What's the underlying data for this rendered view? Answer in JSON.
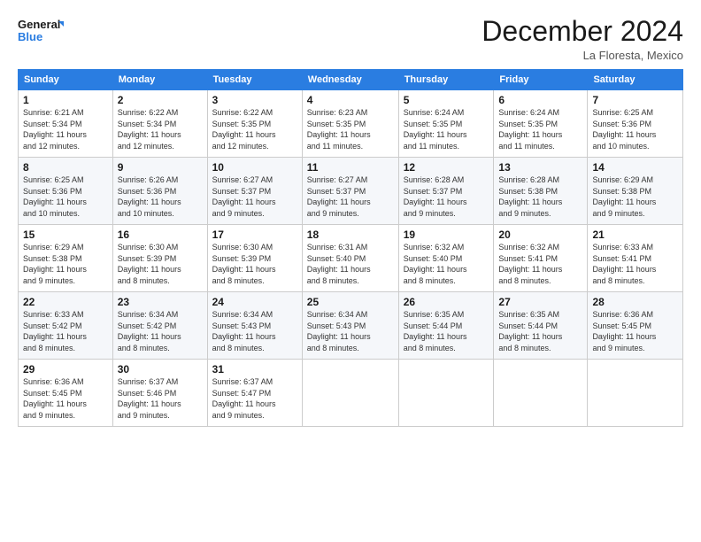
{
  "logo": {
    "line1": "General",
    "line2": "Blue"
  },
  "title": "December 2024",
  "location": "La Floresta, Mexico",
  "days_of_week": [
    "Sunday",
    "Monday",
    "Tuesday",
    "Wednesday",
    "Thursday",
    "Friday",
    "Saturday"
  ],
  "weeks": [
    [
      {
        "day": "1",
        "info": "Sunrise: 6:21 AM\nSunset: 5:34 PM\nDaylight: 11 hours\nand 12 minutes."
      },
      {
        "day": "2",
        "info": "Sunrise: 6:22 AM\nSunset: 5:34 PM\nDaylight: 11 hours\nand 12 minutes."
      },
      {
        "day": "3",
        "info": "Sunrise: 6:22 AM\nSunset: 5:35 PM\nDaylight: 11 hours\nand 12 minutes."
      },
      {
        "day": "4",
        "info": "Sunrise: 6:23 AM\nSunset: 5:35 PM\nDaylight: 11 hours\nand 11 minutes."
      },
      {
        "day": "5",
        "info": "Sunrise: 6:24 AM\nSunset: 5:35 PM\nDaylight: 11 hours\nand 11 minutes."
      },
      {
        "day": "6",
        "info": "Sunrise: 6:24 AM\nSunset: 5:35 PM\nDaylight: 11 hours\nand 11 minutes."
      },
      {
        "day": "7",
        "info": "Sunrise: 6:25 AM\nSunset: 5:36 PM\nDaylight: 11 hours\nand 10 minutes."
      }
    ],
    [
      {
        "day": "8",
        "info": "Sunrise: 6:25 AM\nSunset: 5:36 PM\nDaylight: 11 hours\nand 10 minutes."
      },
      {
        "day": "9",
        "info": "Sunrise: 6:26 AM\nSunset: 5:36 PM\nDaylight: 11 hours\nand 10 minutes."
      },
      {
        "day": "10",
        "info": "Sunrise: 6:27 AM\nSunset: 5:37 PM\nDaylight: 11 hours\nand 9 minutes."
      },
      {
        "day": "11",
        "info": "Sunrise: 6:27 AM\nSunset: 5:37 PM\nDaylight: 11 hours\nand 9 minutes."
      },
      {
        "day": "12",
        "info": "Sunrise: 6:28 AM\nSunset: 5:37 PM\nDaylight: 11 hours\nand 9 minutes."
      },
      {
        "day": "13",
        "info": "Sunrise: 6:28 AM\nSunset: 5:38 PM\nDaylight: 11 hours\nand 9 minutes."
      },
      {
        "day": "14",
        "info": "Sunrise: 6:29 AM\nSunset: 5:38 PM\nDaylight: 11 hours\nand 9 minutes."
      }
    ],
    [
      {
        "day": "15",
        "info": "Sunrise: 6:29 AM\nSunset: 5:38 PM\nDaylight: 11 hours\nand 9 minutes."
      },
      {
        "day": "16",
        "info": "Sunrise: 6:30 AM\nSunset: 5:39 PM\nDaylight: 11 hours\nand 8 minutes."
      },
      {
        "day": "17",
        "info": "Sunrise: 6:30 AM\nSunset: 5:39 PM\nDaylight: 11 hours\nand 8 minutes."
      },
      {
        "day": "18",
        "info": "Sunrise: 6:31 AM\nSunset: 5:40 PM\nDaylight: 11 hours\nand 8 minutes."
      },
      {
        "day": "19",
        "info": "Sunrise: 6:32 AM\nSunset: 5:40 PM\nDaylight: 11 hours\nand 8 minutes."
      },
      {
        "day": "20",
        "info": "Sunrise: 6:32 AM\nSunset: 5:41 PM\nDaylight: 11 hours\nand 8 minutes."
      },
      {
        "day": "21",
        "info": "Sunrise: 6:33 AM\nSunset: 5:41 PM\nDaylight: 11 hours\nand 8 minutes."
      }
    ],
    [
      {
        "day": "22",
        "info": "Sunrise: 6:33 AM\nSunset: 5:42 PM\nDaylight: 11 hours\nand 8 minutes."
      },
      {
        "day": "23",
        "info": "Sunrise: 6:34 AM\nSunset: 5:42 PM\nDaylight: 11 hours\nand 8 minutes."
      },
      {
        "day": "24",
        "info": "Sunrise: 6:34 AM\nSunset: 5:43 PM\nDaylight: 11 hours\nand 8 minutes."
      },
      {
        "day": "25",
        "info": "Sunrise: 6:34 AM\nSunset: 5:43 PM\nDaylight: 11 hours\nand 8 minutes."
      },
      {
        "day": "26",
        "info": "Sunrise: 6:35 AM\nSunset: 5:44 PM\nDaylight: 11 hours\nand 8 minutes."
      },
      {
        "day": "27",
        "info": "Sunrise: 6:35 AM\nSunset: 5:44 PM\nDaylight: 11 hours\nand 8 minutes."
      },
      {
        "day": "28",
        "info": "Sunrise: 6:36 AM\nSunset: 5:45 PM\nDaylight: 11 hours\nand 9 minutes."
      }
    ],
    [
      {
        "day": "29",
        "info": "Sunrise: 6:36 AM\nSunset: 5:45 PM\nDaylight: 11 hours\nand 9 minutes."
      },
      {
        "day": "30",
        "info": "Sunrise: 6:37 AM\nSunset: 5:46 PM\nDaylight: 11 hours\nand 9 minutes."
      },
      {
        "day": "31",
        "info": "Sunrise: 6:37 AM\nSunset: 5:47 PM\nDaylight: 11 hours\nand 9 minutes."
      },
      {
        "day": "",
        "info": ""
      },
      {
        "day": "",
        "info": ""
      },
      {
        "day": "",
        "info": ""
      },
      {
        "day": "",
        "info": ""
      }
    ]
  ]
}
